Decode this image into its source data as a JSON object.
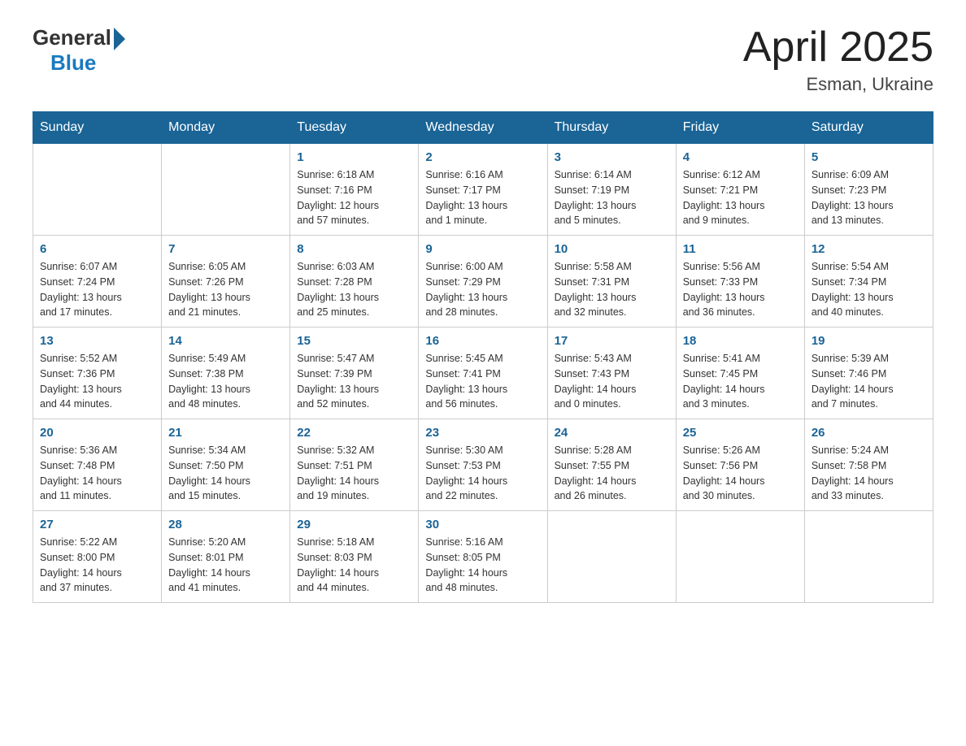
{
  "header": {
    "logo_general": "General",
    "logo_blue": "Blue",
    "title": "April 2025",
    "location": "Esman, Ukraine"
  },
  "days_of_week": [
    "Sunday",
    "Monday",
    "Tuesday",
    "Wednesday",
    "Thursday",
    "Friday",
    "Saturday"
  ],
  "weeks": [
    [
      {
        "day": "",
        "info": ""
      },
      {
        "day": "",
        "info": ""
      },
      {
        "day": "1",
        "info": "Sunrise: 6:18 AM\nSunset: 7:16 PM\nDaylight: 12 hours\nand 57 minutes."
      },
      {
        "day": "2",
        "info": "Sunrise: 6:16 AM\nSunset: 7:17 PM\nDaylight: 13 hours\nand 1 minute."
      },
      {
        "day": "3",
        "info": "Sunrise: 6:14 AM\nSunset: 7:19 PM\nDaylight: 13 hours\nand 5 minutes."
      },
      {
        "day": "4",
        "info": "Sunrise: 6:12 AM\nSunset: 7:21 PM\nDaylight: 13 hours\nand 9 minutes."
      },
      {
        "day": "5",
        "info": "Sunrise: 6:09 AM\nSunset: 7:23 PM\nDaylight: 13 hours\nand 13 minutes."
      }
    ],
    [
      {
        "day": "6",
        "info": "Sunrise: 6:07 AM\nSunset: 7:24 PM\nDaylight: 13 hours\nand 17 minutes."
      },
      {
        "day": "7",
        "info": "Sunrise: 6:05 AM\nSunset: 7:26 PM\nDaylight: 13 hours\nand 21 minutes."
      },
      {
        "day": "8",
        "info": "Sunrise: 6:03 AM\nSunset: 7:28 PM\nDaylight: 13 hours\nand 25 minutes."
      },
      {
        "day": "9",
        "info": "Sunrise: 6:00 AM\nSunset: 7:29 PM\nDaylight: 13 hours\nand 28 minutes."
      },
      {
        "day": "10",
        "info": "Sunrise: 5:58 AM\nSunset: 7:31 PM\nDaylight: 13 hours\nand 32 minutes."
      },
      {
        "day": "11",
        "info": "Sunrise: 5:56 AM\nSunset: 7:33 PM\nDaylight: 13 hours\nand 36 minutes."
      },
      {
        "day": "12",
        "info": "Sunrise: 5:54 AM\nSunset: 7:34 PM\nDaylight: 13 hours\nand 40 minutes."
      }
    ],
    [
      {
        "day": "13",
        "info": "Sunrise: 5:52 AM\nSunset: 7:36 PM\nDaylight: 13 hours\nand 44 minutes."
      },
      {
        "day": "14",
        "info": "Sunrise: 5:49 AM\nSunset: 7:38 PM\nDaylight: 13 hours\nand 48 minutes."
      },
      {
        "day": "15",
        "info": "Sunrise: 5:47 AM\nSunset: 7:39 PM\nDaylight: 13 hours\nand 52 minutes."
      },
      {
        "day": "16",
        "info": "Sunrise: 5:45 AM\nSunset: 7:41 PM\nDaylight: 13 hours\nand 56 minutes."
      },
      {
        "day": "17",
        "info": "Sunrise: 5:43 AM\nSunset: 7:43 PM\nDaylight: 14 hours\nand 0 minutes."
      },
      {
        "day": "18",
        "info": "Sunrise: 5:41 AM\nSunset: 7:45 PM\nDaylight: 14 hours\nand 3 minutes."
      },
      {
        "day": "19",
        "info": "Sunrise: 5:39 AM\nSunset: 7:46 PM\nDaylight: 14 hours\nand 7 minutes."
      }
    ],
    [
      {
        "day": "20",
        "info": "Sunrise: 5:36 AM\nSunset: 7:48 PM\nDaylight: 14 hours\nand 11 minutes."
      },
      {
        "day": "21",
        "info": "Sunrise: 5:34 AM\nSunset: 7:50 PM\nDaylight: 14 hours\nand 15 minutes."
      },
      {
        "day": "22",
        "info": "Sunrise: 5:32 AM\nSunset: 7:51 PM\nDaylight: 14 hours\nand 19 minutes."
      },
      {
        "day": "23",
        "info": "Sunrise: 5:30 AM\nSunset: 7:53 PM\nDaylight: 14 hours\nand 22 minutes."
      },
      {
        "day": "24",
        "info": "Sunrise: 5:28 AM\nSunset: 7:55 PM\nDaylight: 14 hours\nand 26 minutes."
      },
      {
        "day": "25",
        "info": "Sunrise: 5:26 AM\nSunset: 7:56 PM\nDaylight: 14 hours\nand 30 minutes."
      },
      {
        "day": "26",
        "info": "Sunrise: 5:24 AM\nSunset: 7:58 PM\nDaylight: 14 hours\nand 33 minutes."
      }
    ],
    [
      {
        "day": "27",
        "info": "Sunrise: 5:22 AM\nSunset: 8:00 PM\nDaylight: 14 hours\nand 37 minutes."
      },
      {
        "day": "28",
        "info": "Sunrise: 5:20 AM\nSunset: 8:01 PM\nDaylight: 14 hours\nand 41 minutes."
      },
      {
        "day": "29",
        "info": "Sunrise: 5:18 AM\nSunset: 8:03 PM\nDaylight: 14 hours\nand 44 minutes."
      },
      {
        "day": "30",
        "info": "Sunrise: 5:16 AM\nSunset: 8:05 PM\nDaylight: 14 hours\nand 48 minutes."
      },
      {
        "day": "",
        "info": ""
      },
      {
        "day": "",
        "info": ""
      },
      {
        "day": "",
        "info": ""
      }
    ]
  ]
}
